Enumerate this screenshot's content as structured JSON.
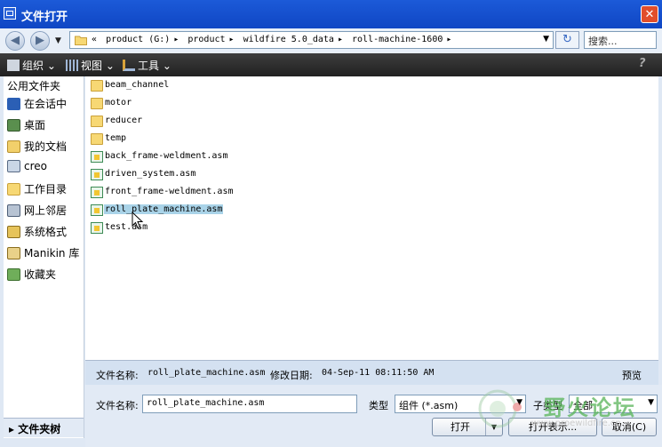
{
  "window": {
    "title": "文件打开"
  },
  "nav": {
    "back_icon": "back-arrow-icon",
    "forward_icon": "forward-arrow-icon",
    "breadcrumb_prefix": "«",
    "breadcrumb": [
      "product (G:)",
      "product",
      "wildfire 5.0_data",
      "roll-machine-1600"
    ],
    "search_placeholder": "搜索..."
  },
  "toolbar": {
    "organize": "组织",
    "view": "视图",
    "tools": "工具"
  },
  "sidebar": {
    "header": "公用文件夹",
    "items": [
      {
        "label": "在会话中",
        "icon": "session-icon"
      },
      {
        "label": "桌面",
        "icon": "desktop-icon"
      },
      {
        "label": "我的文档",
        "icon": "documents-icon"
      },
      {
        "label": "creo",
        "icon": "computer-icon"
      },
      {
        "label": "工作目录",
        "icon": "working-directory-icon"
      },
      {
        "label": "网上邻居",
        "icon": "network-icon"
      },
      {
        "label": "系统格式",
        "icon": "system-format-icon"
      },
      {
        "label": "Manikin 库",
        "icon": "manikin-library-icon"
      },
      {
        "label": "收藏夹",
        "icon": "favorites-icon"
      }
    ],
    "folder_tree_label": "文件夹树"
  },
  "files": [
    {
      "name": "beam_channel",
      "type": "folder"
    },
    {
      "name": "motor",
      "type": "folder"
    },
    {
      "name": "reducer",
      "type": "folder"
    },
    {
      "name": "temp",
      "type": "folder"
    },
    {
      "name": "back_frame-weldment.asm",
      "type": "asm"
    },
    {
      "name": "driven_system.asm",
      "type": "asm"
    },
    {
      "name": "front_frame-weldment.asm",
      "type": "asm"
    },
    {
      "name": "roll_plate_machine.asm",
      "type": "asm",
      "selected": true
    },
    {
      "name": "test.asm",
      "type": "asm"
    }
  ],
  "details": {
    "name_label": "文件名称:",
    "name_value": "roll_plate_machine.asm",
    "date_label": "修改日期:",
    "date_value": "04-Sep-11 08:11:50 AM",
    "preview_label": "预览"
  },
  "form": {
    "filename_label": "文件名称:",
    "filename_value": "roll_plate_machine.asm",
    "type_label": "类型",
    "type_value": "组件 (*.asm)",
    "subtype_label": "子类型",
    "subtype_value": "全部"
  },
  "buttons": {
    "open": "打开",
    "show": "打开表示...",
    "cancel": "取消(C)"
  },
  "watermark": {
    "text": "野火论坛",
    "url": "www.proewildfire.cn"
  }
}
